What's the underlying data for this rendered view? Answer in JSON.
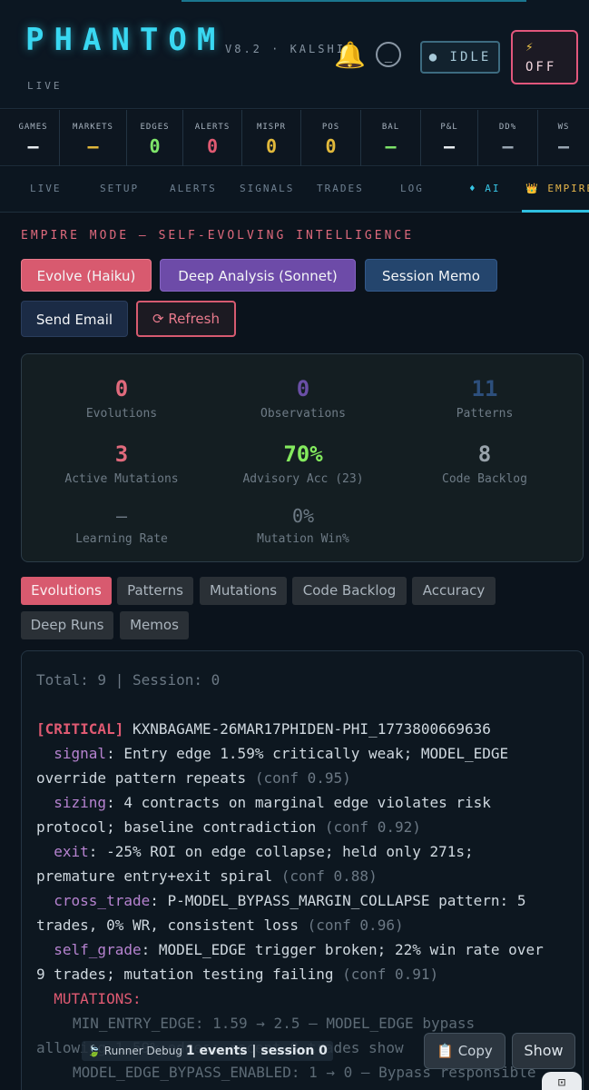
{
  "header": {
    "brand": "PHANTOM",
    "version": "V8.2 · KALSHI",
    "live_label": "LIVE",
    "icons": {
      "bell": "bell-icon",
      "circle": "minus-circle-icon"
    },
    "circle_label": "_",
    "idle_label": "● IDLE",
    "off_label": "OFF",
    "off_icon": "⚡",
    "colors": {
      "accent": "#39d8f2",
      "danger": "#e2577c"
    }
  },
  "stats": [
    {
      "label": "GAMES",
      "value": "—",
      "color": "#e9eef2"
    },
    {
      "label": "MARKETS",
      "value": "—",
      "color": "#e2b93b"
    },
    {
      "label": "EDGES",
      "value": "0",
      "color": "#7ee56a"
    },
    {
      "label": "ALERTS",
      "value": "0",
      "color": "#e05a72"
    },
    {
      "label": "MISPR",
      "value": "0",
      "color": "#e2b93b"
    },
    {
      "label": "POS",
      "value": "0",
      "color": "#e2b93b"
    },
    {
      "label": "BAL",
      "value": "—",
      "color": "#7ee56a"
    },
    {
      "label": "P&L",
      "value": "—",
      "color": "#e9eef2"
    },
    {
      "label": "DD%",
      "value": "—",
      "color": "#9aa7b4"
    },
    {
      "label": "WS",
      "value": "—",
      "color": "#9aa7b4"
    }
  ],
  "tabs": [
    "LIVE",
    "SETUP",
    "ALERTS",
    "SIGNALS",
    "TRADES",
    "LOG",
    "♦ AI",
    "👑 EMPIRE"
  ],
  "empire": {
    "title": "EMPIRE MODE — SELF-EVOLVING INTELLIGENCE",
    "buttons": {
      "evolve": "Evolve (Haiku)",
      "deep": "Deep Analysis (Sonnet)",
      "memo": "Session Memo",
      "email": "Send Email",
      "refresh": "⟳ Refresh"
    },
    "metrics": [
      {
        "value": "0",
        "label": "Evolutions",
        "color": "#e06a7c"
      },
      {
        "value": "0",
        "label": "Observations",
        "color": "#6a4fa6"
      },
      {
        "value": "11",
        "label": "Patterns",
        "color": "#2d4f7c"
      },
      {
        "value": "3",
        "label": "Active Mutations",
        "color": "#e06a7c"
      },
      {
        "value": "70%",
        "label": "Advisory Acc (23)",
        "color": "#84ea5e"
      },
      {
        "value": "8",
        "label": "Code Backlog",
        "color": "#98a2aa"
      },
      {
        "value": "—",
        "label": "Learning Rate",
        "color": "#6e7b86"
      },
      {
        "value": "0%",
        "label": "Mutation Win%",
        "color": "#6e7b86"
      }
    ],
    "subtabs": [
      "Evolutions",
      "Patterns",
      "Mutations",
      "Code Backlog",
      "Accuracy",
      "Deep Runs",
      "Memos"
    ]
  },
  "log": {
    "summary": "Total: 9 | Session: 0",
    "critical_tag": "[CRITICAL]",
    "ticker": "KXNBAGAME-26MAR17PHIDEN-PHI_1773800669636",
    "entries": [
      {
        "key": "signal",
        "text": ": Entry edge 1.59% critically weak; MODEL_EDGE",
        "cont": "override pattern repeats",
        "conf": "(conf 0.95)"
      },
      {
        "key": "sizing",
        "text": ": 4 contracts on marginal edge violates risk",
        "cont": "protocol; baseline contradiction",
        "conf": "(conf 0.92)"
      },
      {
        "key": "exit",
        "text": ": -25% ROI on edge collapse; held only 271s;",
        "cont": "premature entry+exit spiral",
        "conf": "(conf 0.88)"
      },
      {
        "key": "cross_trade",
        "text": ": P-MODEL_BYPASS_MARGIN_COLLAPSE pattern: 5",
        "cont": "trades, 0% WR, consistent loss",
        "conf": "(conf 0.96)"
      },
      {
        "key": "self_grade",
        "text": ": MODEL_EDGE trigger broken; 22% win rate over",
        "cont": "9 trades; mutation testing failing",
        "conf": "(conf 0.91)"
      }
    ],
    "mutations_header": "MUTATIONS:",
    "mutation_lines": [
      "MIN_ENTRY_EDGE: 1.59 → 2.5 — MODEL_EDGE bypass",
      "allowing 1.59% edges; recent 8 trades show",
      "MODEL_EDGE_BYPASS_ENABLED: 1 → 0 — Bypass responsible"
    ]
  },
  "toolbar": {
    "runner_label": "Runner Debug",
    "runner_events": "1 events | session 0",
    "copy_label": "Copy",
    "copy_icon": "clipboard-icon",
    "show_label": "Show",
    "scan_icon": "scan-icon"
  }
}
